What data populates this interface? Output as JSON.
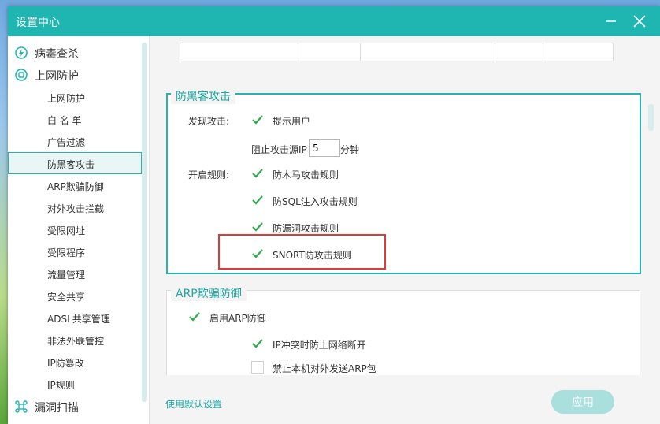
{
  "window": {
    "title": "设置中心"
  },
  "sidebar": {
    "virus_scan": "病毒查杀",
    "net_protect": "上网防护",
    "items": [
      {
        "label": "上网防护"
      },
      {
        "label": "白 名 单"
      },
      {
        "label": "广告过滤"
      },
      {
        "label": "防黑客攻击",
        "active": true
      },
      {
        "label": "ARP欺骗防御"
      },
      {
        "label": "对外攻击拦截"
      },
      {
        "label": "受限网址"
      },
      {
        "label": "受限程序"
      },
      {
        "label": "流量管理"
      },
      {
        "label": "安全共享"
      },
      {
        "label": "ADSL共享管理"
      },
      {
        "label": "非法外联管控"
      },
      {
        "label": "IP防篡改"
      },
      {
        "label": "IP规则"
      }
    ],
    "vuln_scan": "漏洞扫描"
  },
  "anti_hacker": {
    "title": "防黑客攻击",
    "detect_label": "发现攻击:",
    "notify_user": {
      "label": "提示用户",
      "checked": true
    },
    "block_prefix": "阻止攻击源IP",
    "block_minutes": "5",
    "block_suffix": "分钟",
    "rules_label": "开启规则:",
    "rules": [
      {
        "label": "防木马攻击规则",
        "checked": true
      },
      {
        "label": "防SQL注入攻击规则",
        "checked": true
      },
      {
        "label": "防漏洞攻击规则",
        "checked": true
      },
      {
        "label": "SNORT防攻击规则",
        "checked": true
      }
    ]
  },
  "arp": {
    "title": "ARP欺骗防御",
    "enable": {
      "label": "启用ARP防御",
      "checked": true
    },
    "ip_conflict": {
      "label": "IP冲突时防止网络断开",
      "checked": true
    },
    "block_send": {
      "label": "禁止本机对外发送ARP包",
      "checked": false
    }
  },
  "footer": {
    "use_default": "使用默认设置",
    "apply": "应用"
  },
  "colors": {
    "accent": "#1fb5b0",
    "check": "#2fa84f",
    "highlight_border": "#e23a3a"
  }
}
